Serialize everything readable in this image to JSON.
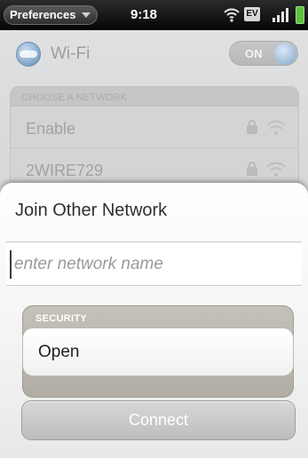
{
  "status_bar": {
    "app_menu_label": "Preferences",
    "time": "9:18",
    "network_badge": "EV"
  },
  "wifi": {
    "title": "Wi-Fi",
    "toggle_label": "ON"
  },
  "network_list": {
    "heading": "CHOOSE A NETWORK",
    "networks": [
      {
        "name": "Enable",
        "secured": true
      },
      {
        "name": "2WIRE729",
        "secured": true
      }
    ]
  },
  "dialog": {
    "title": "Join Other Network",
    "network_name_value": "",
    "network_name_placeholder": "enter network name",
    "security_label": "SECURITY",
    "security_value": "Open",
    "connect_label": "Connect"
  },
  "colors": {
    "status_bar": "#111111",
    "battery": "#5ec13f",
    "toggle_knob": "#9bb9d7",
    "security_group": "#b8b4ab",
    "connect_button": "#c9c9c9"
  }
}
